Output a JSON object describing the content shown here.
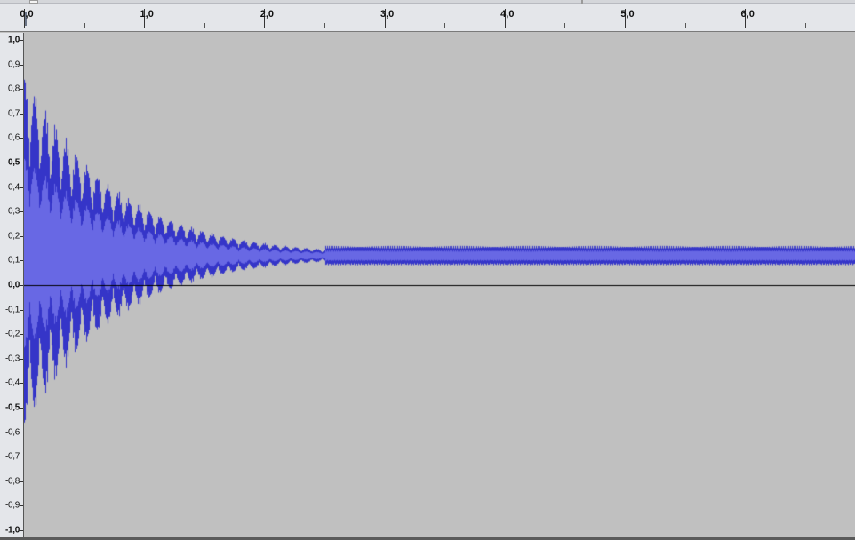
{
  "ruler": {
    "labels": [
      "0,0",
      "1,0",
      "2,0",
      "3,0",
      "4,0",
      "5,0",
      "6,0"
    ],
    "label_values": [
      0,
      1,
      2,
      3,
      4,
      5,
      6
    ],
    "minor_step": 0.5
  },
  "amplitude_ruler": {
    "labels": [
      "1,0",
      "0,9",
      "0,8",
      "0,7",
      "0,6",
      "0,5",
      "0,4",
      "0,3",
      "0,2",
      "0,1",
      "0,0",
      "-0,1",
      "-0,2",
      "-0,3",
      "-0,4",
      "-0,5",
      "-0,6",
      "-0,7",
      "-0,8",
      "-0,9",
      "-1,0"
    ],
    "values": [
      1.0,
      0.9,
      0.8,
      0.7,
      0.6,
      0.5,
      0.4,
      0.3,
      0.2,
      0.1,
      0.0,
      -0.1,
      -0.2,
      -0.3,
      -0.4,
      -0.5,
      -0.6,
      -0.7,
      -0.8,
      -0.9,
      -1.0
    ],
    "bold_labels": [
      "1,0",
      "0,5",
      "0,0",
      "-0,5",
      "-1,0"
    ]
  },
  "colors": {
    "waveform_outer": "#3535c8",
    "waveform_inner": "#6868e4",
    "background": "#c0c0c0",
    "zero_line": "#000000"
  },
  "waveform": {
    "visible_time_range": [
      0,
      6.9
    ],
    "dc_offset_tail": 0.12,
    "peak_max": 0.9,
    "peak_min": -0.62
  }
}
